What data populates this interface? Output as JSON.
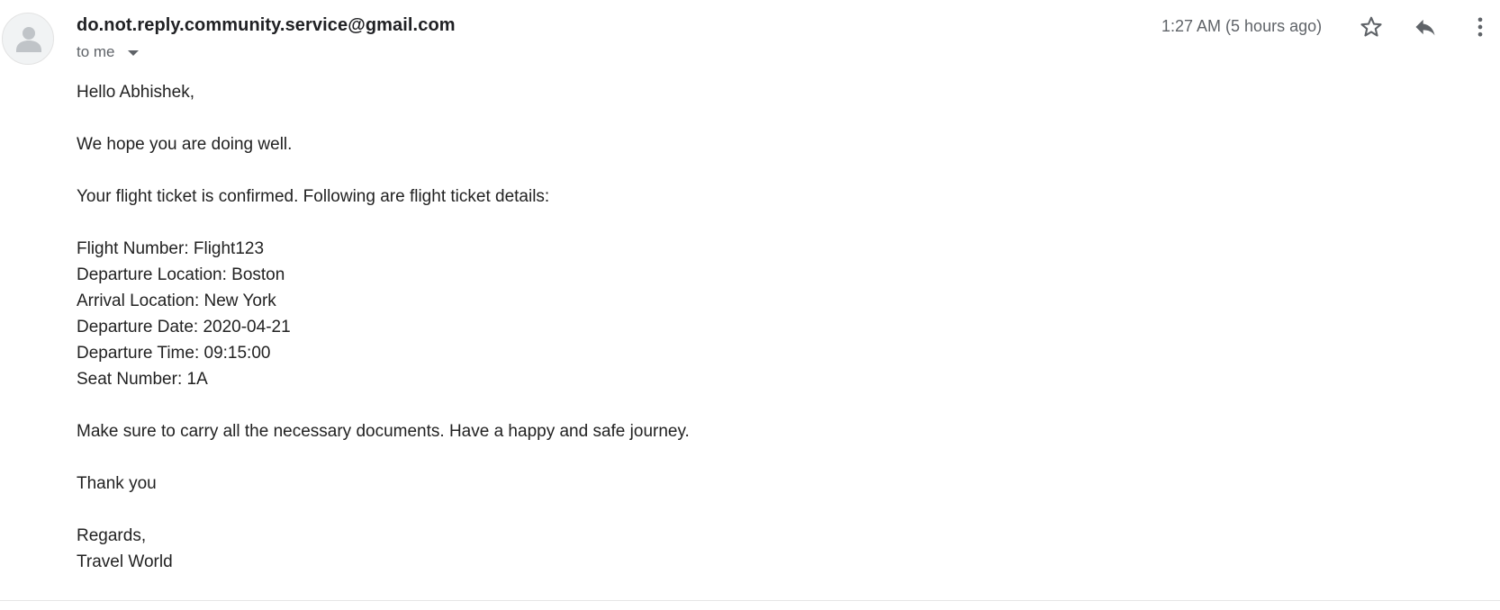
{
  "email": {
    "sender": "do.not.reply.community.service@gmail.com",
    "recipients_label": "to me",
    "timestamp": "1:27 AM (5 hours ago)",
    "icons": {
      "avatar": "person-icon",
      "star": "star-outline-icon",
      "reply": "reply-icon",
      "more": "more-vert-icon",
      "recipients_toggle": "caret-down-icon"
    },
    "body": {
      "greeting": "Hello Abhishek,",
      "line1": "We hope you are doing well.",
      "line2": "Your flight ticket is confirmed. Following are flight ticket details:",
      "details": [
        "Flight Number: Flight123",
        "Departure Location: Boston",
        "Arrival Location: New York",
        "Departure Date: 2020-04-21",
        "Departure Time: 09:15:00",
        "Seat Number: 1A"
      ],
      "line3": "Make sure to carry all the necessary documents. Have a happy and safe journey.",
      "thanks": "Thank you",
      "regards": "Regards,",
      "signature": "Travel World"
    }
  },
  "colors": {
    "text": "#222222",
    "muted": "#5f6368",
    "avatar_bg": "#f1f3f4",
    "avatar_fg": "#c0c4c8",
    "divider": "#e6e6e6"
  }
}
